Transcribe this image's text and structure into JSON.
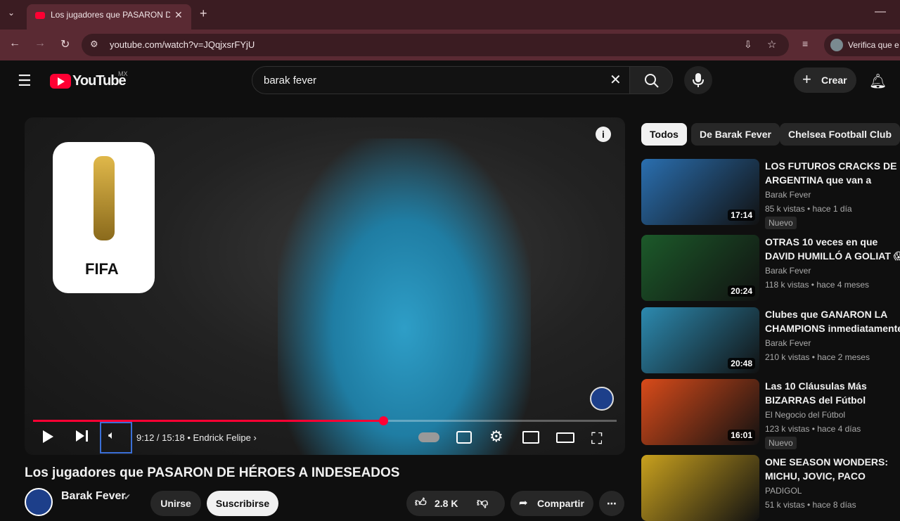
{
  "browser": {
    "tab_title": "Los jugadores que PASARON DE",
    "url": "youtube.com/watch?v=JQqjxsrFYjU",
    "profile_text": "Verifica que e",
    "icons": [
      "chevron-down-icon",
      "close-icon",
      "plus-icon",
      "back-icon",
      "forward-icon",
      "reload-icon",
      "site-info-icon",
      "install-icon",
      "star-icon",
      "media-icon",
      "minimize-icon"
    ]
  },
  "header": {
    "logo_text": "YouTube",
    "region": "MX",
    "search_value": "barak fever",
    "create_label": "Crear"
  },
  "player": {
    "overlay_text": "FIFA",
    "time_current": "9:12",
    "time_total": "15:18",
    "chapter": "Endrick Felipe",
    "progress_fraction": 0.6
  },
  "video": {
    "title": "Los jugadores que PASARON DE HÉROES A INDESEADOS",
    "channel": "Barak Fever",
    "join_label": "Unirse",
    "subscribe_label": "Suscribirse",
    "likes": "2.8 K",
    "share_label": "Compartir"
  },
  "sidebar": {
    "chips": [
      "Todos",
      "De Barak Fever",
      "Chelsea Football Club"
    ],
    "recommendations": [
      {
        "title": "LOS FUTUROS CRACKS DE ARGENTINA que van a domina",
        "channel": "Barak Fever",
        "meta": "85 k vistas • hace 1 día",
        "duration": "17:14",
        "badge": "Nuevo",
        "color": "#2a6fb0"
      },
      {
        "title": "OTRAS 10 veces en que DAVID HUMILLÓ A GOLIAT 😱⚽",
        "channel": "Barak Fever",
        "meta": "118 k vistas • hace 4 meses",
        "duration": "20:24",
        "badge": "",
        "color": "#1c5a2a"
      },
      {
        "title": "Clubes que GANARON LA CHAMPIONS inmediatamente",
        "channel": "Barak Fever",
        "meta": "210 k vistas • hace 2 meses",
        "duration": "20:48",
        "badge": "",
        "color": "#2c8ab0"
      },
      {
        "title": "Las 10 Cláusulas Más BIZARRAS del Fútbol",
        "channel": "El Negocio del Fútbol",
        "meta": "123 k vistas • hace 4 días",
        "duration": "16:01",
        "badge": "Nuevo",
        "color": "#d94b1a"
      },
      {
        "title": "ONE SEASON WONDERS: MICHU, JOVIC, PACO ALCÁCE...",
        "channel": "PADIGOL",
        "meta": "51 k vistas • hace 8 días",
        "duration": "",
        "badge": "",
        "color": "#c9a11e"
      }
    ]
  }
}
